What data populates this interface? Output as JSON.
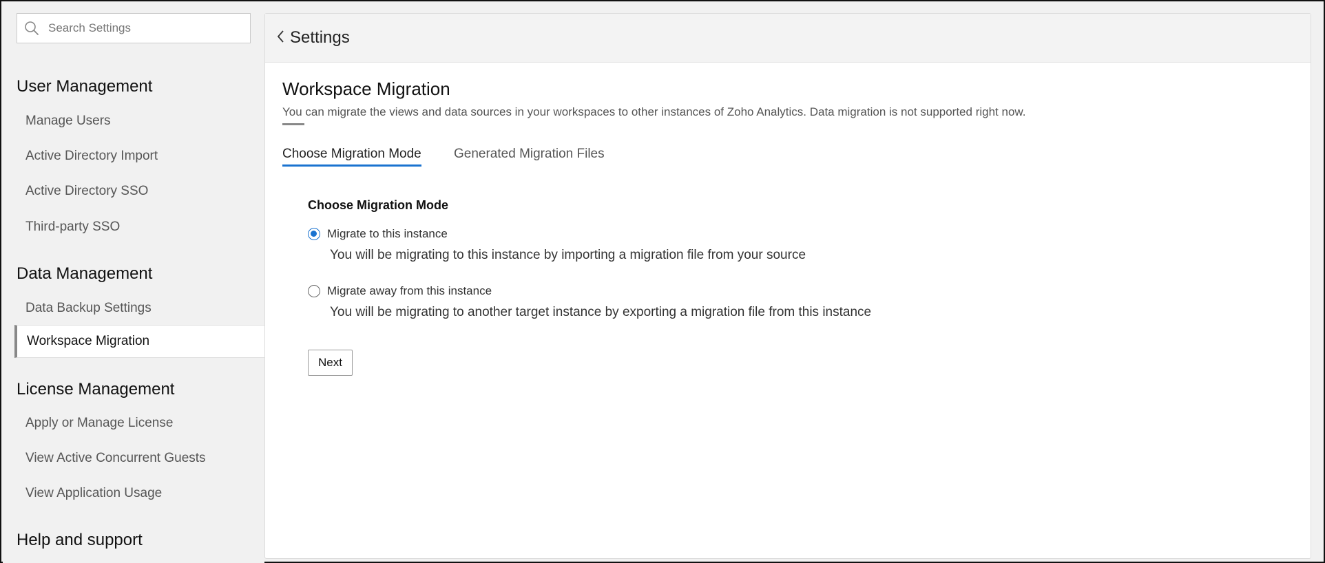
{
  "search": {
    "placeholder": "Search Settings",
    "icon": "search-icon"
  },
  "sidebar": {
    "sections": [
      {
        "title": "User Management",
        "items": [
          "Manage Users",
          "Active Directory Import",
          "Active Directory SSO",
          "Third-party SSO"
        ]
      },
      {
        "title": "Data Management",
        "items": [
          "Data Backup Settings",
          "Workspace Migration"
        ]
      },
      {
        "title": "License Management",
        "items": [
          "Apply or Manage License",
          "View Active Concurrent Guests",
          "View Application Usage"
        ]
      },
      {
        "title": "Help and support",
        "items": []
      }
    ],
    "active_item": "Workspace Migration"
  },
  "header": {
    "back_label": "Settings"
  },
  "page": {
    "title": "Workspace Migration",
    "description": "You can migrate the views and data sources in your workspaces to other instances of Zoho Analytics. Data migration is not supported right now."
  },
  "tabs": [
    {
      "label": "Choose Migration Mode",
      "active": true
    },
    {
      "label": "Generated Migration Files",
      "active": false
    }
  ],
  "form": {
    "title": "Choose Migration Mode",
    "options": [
      {
        "label": "Migrate to this instance",
        "description": "You will be migrating to this instance by importing a migration file from your source",
        "checked": true
      },
      {
        "label": "Migrate away from this instance",
        "description": "You will be migrating to another target instance by exporting a migration file from this instance",
        "checked": false
      }
    ],
    "next_label": "Next"
  },
  "colors": {
    "accent": "#1a73d0",
    "sidebar_bg": "#f1f1f1",
    "panel_bg": "#ffffff"
  }
}
